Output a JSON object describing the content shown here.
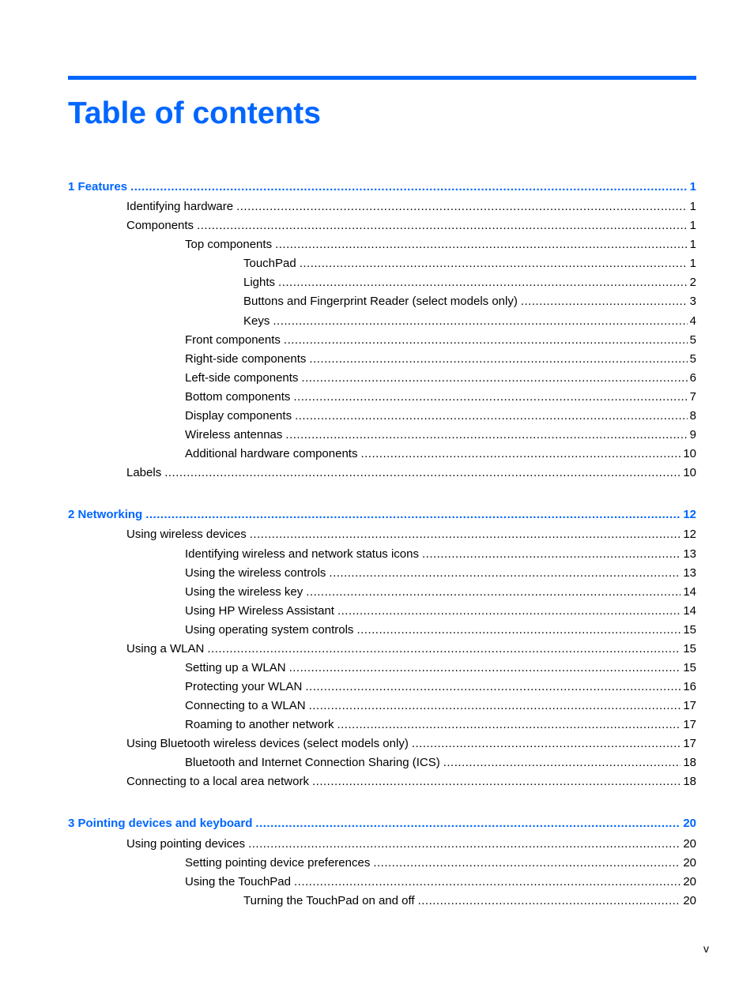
{
  "document": {
    "title": "Table of contents",
    "page_number": "v",
    "accent_color": "#0066ff"
  },
  "toc": [
    {
      "level": 0,
      "chapter": true,
      "label": "1  Features",
      "page": "1"
    },
    {
      "level": 1,
      "label": "Identifying hardware",
      "page": "1"
    },
    {
      "level": 1,
      "label": "Components",
      "page": "1"
    },
    {
      "level": 2,
      "label": "Top components",
      "page": "1"
    },
    {
      "level": 3,
      "label": "TouchPad",
      "page": "1"
    },
    {
      "level": 3,
      "label": "Lights",
      "page": "2"
    },
    {
      "level": 3,
      "label": "Buttons and Fingerprint Reader (select models only)",
      "page": "3"
    },
    {
      "level": 3,
      "label": "Keys",
      "page": "4"
    },
    {
      "level": 2,
      "label": "Front components",
      "page": "5"
    },
    {
      "level": 2,
      "label": "Right-side components",
      "page": "5"
    },
    {
      "level": 2,
      "label": "Left-side components",
      "page": "6"
    },
    {
      "level": 2,
      "label": "Bottom components",
      "page": "7"
    },
    {
      "level": 2,
      "label": "Display components",
      "page": "8"
    },
    {
      "level": 2,
      "label": "Wireless antennas",
      "page": "9"
    },
    {
      "level": 2,
      "label": "Additional hardware components",
      "page": "10"
    },
    {
      "level": 1,
      "label": "Labels",
      "page": "10"
    },
    {
      "level": 0,
      "chapter": true,
      "label": "2  Networking",
      "page": "12"
    },
    {
      "level": 1,
      "label": "Using wireless devices",
      "page": "12"
    },
    {
      "level": 2,
      "label": "Identifying wireless and network status icons",
      "page": "13"
    },
    {
      "level": 2,
      "label": "Using the wireless controls",
      "page": "13"
    },
    {
      "level": 2,
      "label": "Using the wireless key",
      "page": "14"
    },
    {
      "level": 2,
      "label": "Using HP Wireless Assistant",
      "page": "14"
    },
    {
      "level": 2,
      "label": "Using operating system controls",
      "page": "15"
    },
    {
      "level": 1,
      "label": "Using a WLAN",
      "page": "15"
    },
    {
      "level": 2,
      "label": "Setting up a WLAN",
      "page": "15"
    },
    {
      "level": 2,
      "label": "Protecting your WLAN",
      "page": "16"
    },
    {
      "level": 2,
      "label": "Connecting to a WLAN",
      "page": "17"
    },
    {
      "level": 2,
      "label": "Roaming to another network",
      "page": "17"
    },
    {
      "level": 1,
      "label": "Using Bluetooth wireless devices (select models only)",
      "page": "17"
    },
    {
      "level": 2,
      "label": "Bluetooth and Internet Connection Sharing (ICS)",
      "page": "18"
    },
    {
      "level": 1,
      "label": "Connecting to a local area network",
      "page": "18"
    },
    {
      "level": 0,
      "chapter": true,
      "label": "3  Pointing devices and keyboard",
      "page": "20"
    },
    {
      "level": 1,
      "label": "Using pointing devices",
      "page": "20"
    },
    {
      "level": 2,
      "label": "Setting pointing device preferences",
      "page": "20"
    },
    {
      "level": 2,
      "label": "Using the TouchPad",
      "page": "20"
    },
    {
      "level": 3,
      "label": "Turning the TouchPad on and off",
      "page": "20"
    }
  ]
}
